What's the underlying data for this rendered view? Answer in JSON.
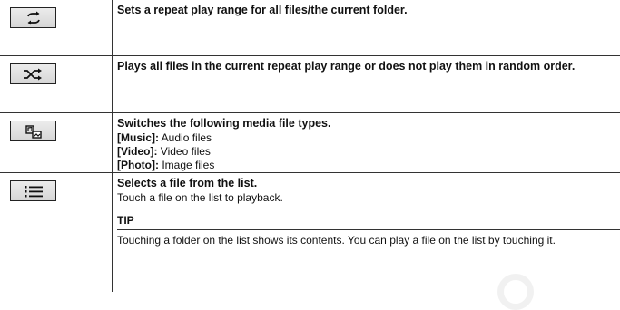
{
  "rows": [
    {
      "icon": "repeat-icon",
      "title": "Sets a repeat play range for all files/the current folder."
    },
    {
      "icon": "random-icon",
      "title": "Plays all files in the current repeat play range or does not play them in random order."
    },
    {
      "icon": "media-switch-icon",
      "title": "Switches the following media file types.",
      "items": [
        {
          "label": "[Music]:",
          "text": " Audio files"
        },
        {
          "label": "[Video]:",
          "text": " Video files"
        },
        {
          "label": "[Photo]:",
          "text": " Image files"
        }
      ]
    },
    {
      "icon": "list-icon",
      "title": "Selects a file from the list.",
      "body": "Touch a file on the list to playback.",
      "tip_label": "TIP",
      "tip_text": "Touching a folder on the list shows its contents. You can play a file on the list by touching it."
    }
  ]
}
